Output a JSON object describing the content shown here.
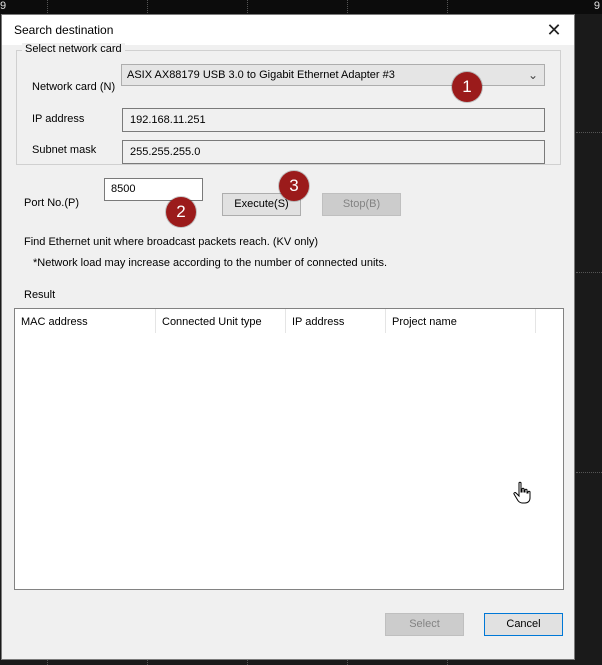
{
  "background": {
    "top_left_number": "9",
    "top_right_number": "9"
  },
  "dialog": {
    "title": "Search destination",
    "close_glyph": "✕",
    "network_group": {
      "title": "Select network card",
      "network_card_label": "Network card (N)",
      "network_card_value": "ASIX AX88179 USB 3.0 to Gigabit Ethernet Adapter #3",
      "ip_label": "IP address",
      "ip_value": "192.168.11.251",
      "subnet_label": "Subnet mask",
      "subnet_value": "255.255.255.0"
    },
    "port_label": "Port No.(P)",
    "port_value": "8500",
    "execute_label": "Execute(S)",
    "stop_label": "Stop(B)",
    "info_line_1": "Find Ethernet unit where broadcast packets reach. (KV only)",
    "info_line_2": "*Network load may increase according to the number of connected units.",
    "result_label": "Result",
    "columns": [
      "MAC address",
      "Connected Unit type",
      "IP address",
      "Project name"
    ],
    "select_label": "Select",
    "cancel_label": "Cancel"
  },
  "badges": [
    "1",
    "2",
    "3"
  ],
  "colors": {
    "badge": "#9b1b1b",
    "dialog_bg": "#f0f0f0",
    "desktop_bg": "#1a1a1a"
  }
}
